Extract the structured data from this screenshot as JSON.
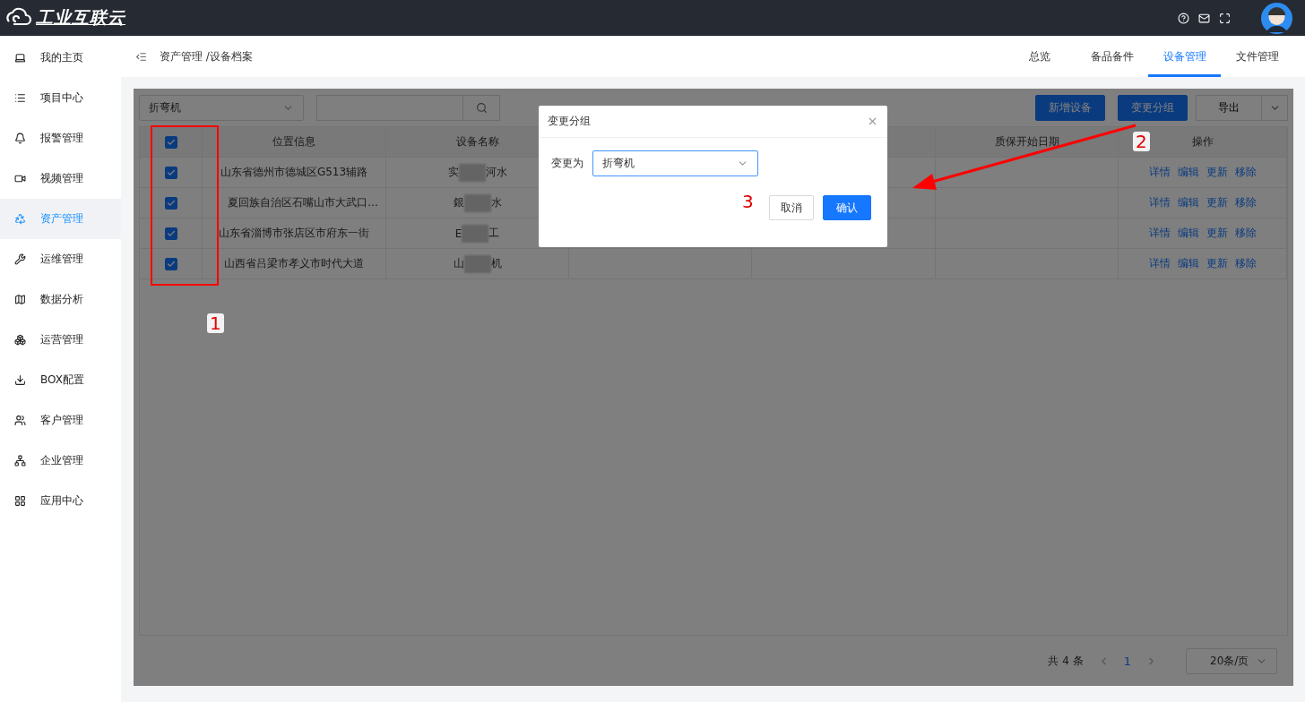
{
  "header": {
    "logo": "工业互联云"
  },
  "sidebar": {
    "items": [
      {
        "label": "我的主页",
        "selected": false
      },
      {
        "label": "项目中心",
        "selected": false
      },
      {
        "label": "报警管理",
        "selected": false
      },
      {
        "label": "视频管理",
        "selected": false
      },
      {
        "label": "资产管理",
        "selected": true
      },
      {
        "label": "运维管理",
        "selected": false
      },
      {
        "label": "数据分析",
        "selected": false
      },
      {
        "label": "运营管理",
        "selected": false
      },
      {
        "label": "BOX配置",
        "selected": false
      },
      {
        "label": "客户管理",
        "selected": false
      },
      {
        "label": "企业管理",
        "selected": false
      },
      {
        "label": "应用中心",
        "selected": false
      }
    ]
  },
  "breadcrumb": "资产管理 /设备档案",
  "tabs": [
    {
      "label": "总览",
      "selected": false
    },
    {
      "label": "备品备件",
      "selected": false
    },
    {
      "label": "设备管理",
      "selected": true
    },
    {
      "label": "文件管理",
      "selected": false
    }
  ],
  "toolbar": {
    "group_select": "折弯机",
    "buttons": [
      "新增设备",
      "变更分组"
    ],
    "export": "导出"
  },
  "table": {
    "header_checked": true,
    "columns": [
      "位置信息",
      "设备名称",
      "质保开始日期",
      "操作"
    ],
    "rows": [
      {
        "checked": true,
        "location": "山东省德州市德城区G513辅路",
        "name_start": "实",
        "name_end": "河水",
        "actions": [
          "详情",
          "编辑",
          "更新",
          "移除"
        ]
      },
      {
        "checked": true,
        "location": "夏回族自治区石嘴山市大武口…",
        "name_start": "銀",
        "name_end": "水",
        "actions": [
          "详情",
          "编辑",
          "更新",
          "移除"
        ]
      },
      {
        "checked": true,
        "location": "山东省淄博市张店区市府东一街",
        "name_start": "E",
        "name_end": "工",
        "actions": [
          "详情",
          "编辑",
          "更新",
          "移除"
        ]
      },
      {
        "checked": true,
        "location": "山西省吕梁市孝义市时代大道",
        "name_start": "山",
        "name_end": "机",
        "actions": [
          "详情",
          "编辑",
          "更新",
          "移除"
        ]
      }
    ]
  },
  "pagination": {
    "total": "共 4 条",
    "pages": [
      {
        "label": "1",
        "selected": true
      }
    ],
    "page_size": "20条/页"
  },
  "dialog": {
    "title": "变更分组",
    "field_label": "变更为",
    "field_value": "折弯机",
    "cancel": "取消",
    "confirm": "确认"
  },
  "annotations": [
    "1",
    "2",
    "3"
  ]
}
